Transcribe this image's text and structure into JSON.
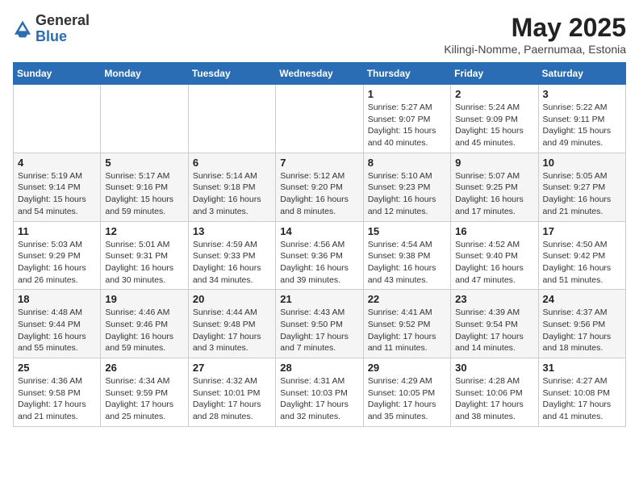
{
  "logo": {
    "general": "General",
    "blue": "Blue"
  },
  "title": "May 2025",
  "subtitle": "Kilingi-Nomme, Paernumaa, Estonia",
  "days_of_week": [
    "Sunday",
    "Monday",
    "Tuesday",
    "Wednesday",
    "Thursday",
    "Friday",
    "Saturday"
  ],
  "weeks": [
    [
      {
        "day": "",
        "info": ""
      },
      {
        "day": "",
        "info": ""
      },
      {
        "day": "",
        "info": ""
      },
      {
        "day": "",
        "info": ""
      },
      {
        "day": "1",
        "info": "Sunrise: 5:27 AM\nSunset: 9:07 PM\nDaylight: 15 hours\nand 40 minutes."
      },
      {
        "day": "2",
        "info": "Sunrise: 5:24 AM\nSunset: 9:09 PM\nDaylight: 15 hours\nand 45 minutes."
      },
      {
        "day": "3",
        "info": "Sunrise: 5:22 AM\nSunset: 9:11 PM\nDaylight: 15 hours\nand 49 minutes."
      }
    ],
    [
      {
        "day": "4",
        "info": "Sunrise: 5:19 AM\nSunset: 9:14 PM\nDaylight: 15 hours\nand 54 minutes."
      },
      {
        "day": "5",
        "info": "Sunrise: 5:17 AM\nSunset: 9:16 PM\nDaylight: 15 hours\nand 59 minutes."
      },
      {
        "day": "6",
        "info": "Sunrise: 5:14 AM\nSunset: 9:18 PM\nDaylight: 16 hours\nand 3 minutes."
      },
      {
        "day": "7",
        "info": "Sunrise: 5:12 AM\nSunset: 9:20 PM\nDaylight: 16 hours\nand 8 minutes."
      },
      {
        "day": "8",
        "info": "Sunrise: 5:10 AM\nSunset: 9:23 PM\nDaylight: 16 hours\nand 12 minutes."
      },
      {
        "day": "9",
        "info": "Sunrise: 5:07 AM\nSunset: 9:25 PM\nDaylight: 16 hours\nand 17 minutes."
      },
      {
        "day": "10",
        "info": "Sunrise: 5:05 AM\nSunset: 9:27 PM\nDaylight: 16 hours\nand 21 minutes."
      }
    ],
    [
      {
        "day": "11",
        "info": "Sunrise: 5:03 AM\nSunset: 9:29 PM\nDaylight: 16 hours\nand 26 minutes."
      },
      {
        "day": "12",
        "info": "Sunrise: 5:01 AM\nSunset: 9:31 PM\nDaylight: 16 hours\nand 30 minutes."
      },
      {
        "day": "13",
        "info": "Sunrise: 4:59 AM\nSunset: 9:33 PM\nDaylight: 16 hours\nand 34 minutes."
      },
      {
        "day": "14",
        "info": "Sunrise: 4:56 AM\nSunset: 9:36 PM\nDaylight: 16 hours\nand 39 minutes."
      },
      {
        "day": "15",
        "info": "Sunrise: 4:54 AM\nSunset: 9:38 PM\nDaylight: 16 hours\nand 43 minutes."
      },
      {
        "day": "16",
        "info": "Sunrise: 4:52 AM\nSunset: 9:40 PM\nDaylight: 16 hours\nand 47 minutes."
      },
      {
        "day": "17",
        "info": "Sunrise: 4:50 AM\nSunset: 9:42 PM\nDaylight: 16 hours\nand 51 minutes."
      }
    ],
    [
      {
        "day": "18",
        "info": "Sunrise: 4:48 AM\nSunset: 9:44 PM\nDaylight: 16 hours\nand 55 minutes."
      },
      {
        "day": "19",
        "info": "Sunrise: 4:46 AM\nSunset: 9:46 PM\nDaylight: 16 hours\nand 59 minutes."
      },
      {
        "day": "20",
        "info": "Sunrise: 4:44 AM\nSunset: 9:48 PM\nDaylight: 17 hours\nand 3 minutes."
      },
      {
        "day": "21",
        "info": "Sunrise: 4:43 AM\nSunset: 9:50 PM\nDaylight: 17 hours\nand 7 minutes."
      },
      {
        "day": "22",
        "info": "Sunrise: 4:41 AM\nSunset: 9:52 PM\nDaylight: 17 hours\nand 11 minutes."
      },
      {
        "day": "23",
        "info": "Sunrise: 4:39 AM\nSunset: 9:54 PM\nDaylight: 17 hours\nand 14 minutes."
      },
      {
        "day": "24",
        "info": "Sunrise: 4:37 AM\nSunset: 9:56 PM\nDaylight: 17 hours\nand 18 minutes."
      }
    ],
    [
      {
        "day": "25",
        "info": "Sunrise: 4:36 AM\nSunset: 9:58 PM\nDaylight: 17 hours\nand 21 minutes."
      },
      {
        "day": "26",
        "info": "Sunrise: 4:34 AM\nSunset: 9:59 PM\nDaylight: 17 hours\nand 25 minutes."
      },
      {
        "day": "27",
        "info": "Sunrise: 4:32 AM\nSunset: 10:01 PM\nDaylight: 17 hours\nand 28 minutes."
      },
      {
        "day": "28",
        "info": "Sunrise: 4:31 AM\nSunset: 10:03 PM\nDaylight: 17 hours\nand 32 minutes."
      },
      {
        "day": "29",
        "info": "Sunrise: 4:29 AM\nSunset: 10:05 PM\nDaylight: 17 hours\nand 35 minutes."
      },
      {
        "day": "30",
        "info": "Sunrise: 4:28 AM\nSunset: 10:06 PM\nDaylight: 17 hours\nand 38 minutes."
      },
      {
        "day": "31",
        "info": "Sunrise: 4:27 AM\nSunset: 10:08 PM\nDaylight: 17 hours\nand 41 minutes."
      }
    ]
  ]
}
